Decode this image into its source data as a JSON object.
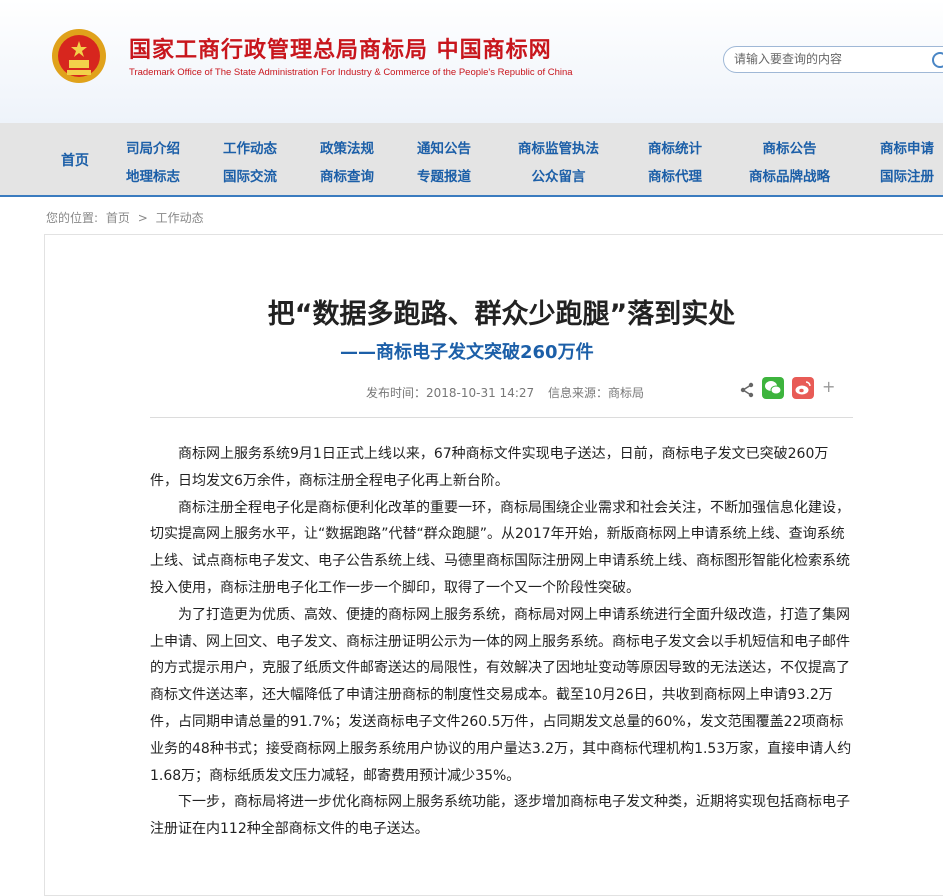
{
  "header": {
    "title_cn": "国家工商行政管理总局商标局 中国商标网",
    "title_en": "Trademark Office of The State Administration For Industry & Commerce of the People's Republic of China",
    "search_placeholder": "请输入要查询的内容"
  },
  "nav": {
    "home": "首页",
    "columns": [
      [
        "司局介绍",
        "地理标志"
      ],
      [
        "工作动态",
        "国际交流"
      ],
      [
        "政策法规",
        "商标查询"
      ],
      [
        "通知公告",
        "专题报道"
      ],
      [
        "商标监管执法",
        "公众留言"
      ],
      [
        "商标统计",
        "商标代理"
      ],
      [
        "商标公告",
        "商标品牌战略"
      ],
      [
        "商标申请",
        "国际注册"
      ]
    ]
  },
  "breadcrumb": {
    "label": "您的位置:",
    "home": "首页",
    "sep": ">",
    "current": "工作动态"
  },
  "article": {
    "title": "把“数据多跑路、群众少跑腿”落到实处",
    "subtitle": "——商标电子发文突破260万件",
    "publish_time": "发布时间：2018-10-31 14:27",
    "source": "信息来源：商标局",
    "paragraphs": [
      "商标网上服务系统9月1日正式上线以来，67种商标文件实现电子送达，日前，商标电子发文已突破260万件，日均发文6万余件，商标注册全程电子化再上新台阶。",
      "商标注册全程电子化是商标便利化改革的重要一环，商标局围绕企业需求和社会关注，不断加强信息化建设，切实提高网上服务水平，让“数据跑路”代替“群众跑腿”。从2017年开始，新版商标网上申请系统上线、查询系统上线、试点商标电子发文、电子公告系统上线、马德里商标国际注册网上申请系统上线、商标图形智能化检索系统投入使用，商标注册电子化工作一步一个脚印，取得了一个又一个阶段性突破。",
      "为了打造更为优质、高效、便捷的商标网上服务系统，商标局对网上申请系统进行全面升级改造，打造了集网上申请、网上回文、电子发文、商标注册证明公示为一体的网上服务系统。商标电子发文会以手机短信和电子邮件的方式提示用户，克服了纸质文件邮寄送达的局限性，有效解决了因地址变动等原因导致的无法送达，不仅提高了商标文件送达率，还大幅降低了申请注册商标的制度性交易成本。截至10月26日，共收到商标网上申请93.2万件，占同期申请总量的91.7%；发送商标电子文件260.5万件，占同期发文总量的60%，发文范围覆盖22项商标业务的48种书式；接受商标网上服务系统用户协议的用户量达3.2万，其中商标代理机构1.53万家，直接申请人约1.68万；商标纸质发文压力减轻，邮寄费用预计减少35%。",
      "下一步，商标局将进一步优化商标网上服务系统功能，逐步增加商标电子发文种类，近期将实现包括商标电子注册证在内112种全部商标文件的电子送达。"
    ]
  }
}
